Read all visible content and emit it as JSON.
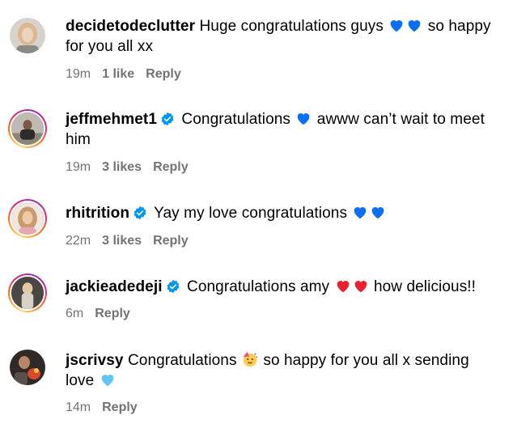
{
  "comments": [
    {
      "username": "decidetodeclutter",
      "verified": false,
      "text_before": "Huge congratulations guys",
      "emoji": "blue-heart-emoji",
      "emoji_count": 2,
      "text_after": "so happy for you all xx",
      "time": "19m",
      "likes": "1 like",
      "reply": "Reply"
    },
    {
      "username": "jeffmehmet1",
      "verified": true,
      "text_before": "Congratulations",
      "emoji": "blue-heart-emoji",
      "emoji_count": 1,
      "text_after": "awww can’t wait to meet him",
      "time": "19m",
      "likes": "3 likes",
      "reply": "Reply"
    },
    {
      "username": "rhitrition",
      "verified": true,
      "text_before": "Yay my love congratulations",
      "emoji": "blue-heart-emoji",
      "emoji_count": 2,
      "text_after": "",
      "time": "22m",
      "likes": "3 likes",
      "reply": "Reply"
    },
    {
      "username": "jackieadedeji",
      "verified": true,
      "text_before": "Congratulations amy",
      "emoji": "red-heart-emoji",
      "emoji_count": 2,
      "text_after": "how delicious!!",
      "time": "6m",
      "likes": "",
      "reply": "Reply"
    },
    {
      "username": "jscrivsy",
      "verified": false,
      "text_before": "Congratulations",
      "emoji": "partying-face-emoji",
      "emoji_count": 1,
      "text_after": "so happy for you all x sending love",
      "trailing_emoji": "light-blue-heart-emoji",
      "time": "14m",
      "likes": "",
      "reply": "Reply"
    }
  ],
  "colors": {
    "text": "#000000",
    "meta": "#737373",
    "verified": "#0095f6",
    "blue_heart": "#0a6ff2",
    "red_heart": "#e8232f",
    "light_blue_heart": "#62c6f5"
  }
}
